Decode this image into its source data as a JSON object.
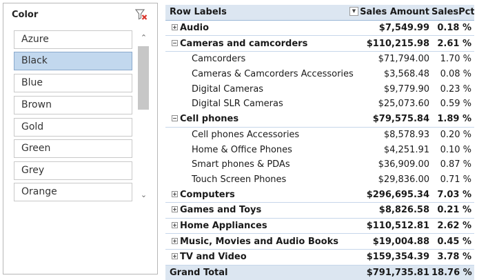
{
  "slicer": {
    "title": "Color",
    "items": [
      {
        "label": "Azure",
        "selected": false
      },
      {
        "label": "Black",
        "selected": true
      },
      {
        "label": "Blue",
        "selected": false
      },
      {
        "label": "Brown",
        "selected": false
      },
      {
        "label": "Gold",
        "selected": false
      },
      {
        "label": "Green",
        "selected": false
      },
      {
        "label": "Grey",
        "selected": false
      },
      {
        "label": "Orange",
        "selected": false
      }
    ]
  },
  "pivot": {
    "headers": {
      "row_labels": "Row Labels",
      "sales_amount": "Sales Amount",
      "sales_pct": "SalesPct"
    },
    "rows": [
      {
        "label": "Audio",
        "amount": "$7,549.99",
        "pct": "0.18 %"
      },
      {
        "label": "Cameras and camcorders",
        "amount": "$110,215.98",
        "pct": "2.61 %"
      },
      {
        "label": "Camcorders",
        "amount": "$71,794.00",
        "pct": "1.70 %"
      },
      {
        "label": "Cameras & Camcorders Accessories",
        "amount": "$3,568.48",
        "pct": "0.08 %"
      },
      {
        "label": "Digital Cameras",
        "amount": "$9,779.90",
        "pct": "0.23 %"
      },
      {
        "label": "Digital SLR Cameras",
        "amount": "$25,073.60",
        "pct": "0.59 %"
      },
      {
        "label": "Cell phones",
        "amount": "$79,575.84",
        "pct": "1.89 %"
      },
      {
        "label": "Cell phones Accessories",
        "amount": "$8,578.93",
        "pct": "0.20 %"
      },
      {
        "label": "Home & Office Phones",
        "amount": "$4,251.91",
        "pct": "0.10 %"
      },
      {
        "label": "Smart phones & PDAs",
        "amount": "$36,909.00",
        "pct": "0.87 %"
      },
      {
        "label": "Touch Screen Phones",
        "amount": "$29,836.00",
        "pct": "0.71 %"
      },
      {
        "label": "Computers",
        "amount": "$296,695.34",
        "pct": "7.03 %"
      },
      {
        "label": "Games and Toys",
        "amount": "$8,826.58",
        "pct": "0.21 %"
      },
      {
        "label": "Home Appliances",
        "amount": "$110,512.81",
        "pct": "2.62 %"
      },
      {
        "label": "Music, Movies and Audio Books",
        "amount": "$19,004.88",
        "pct": "0.45 %"
      },
      {
        "label": "TV and Video",
        "amount": "$159,354.39",
        "pct": "3.78 %"
      }
    ],
    "grand_total": {
      "label": "Grand Total",
      "amount": "$791,735.81",
      "pct": "18.76 %"
    }
  },
  "colors": {
    "header_bg": "#dce6f1",
    "selected_item_bg": "#c2d8ee",
    "clear_filter_red": "#d9342b"
  }
}
